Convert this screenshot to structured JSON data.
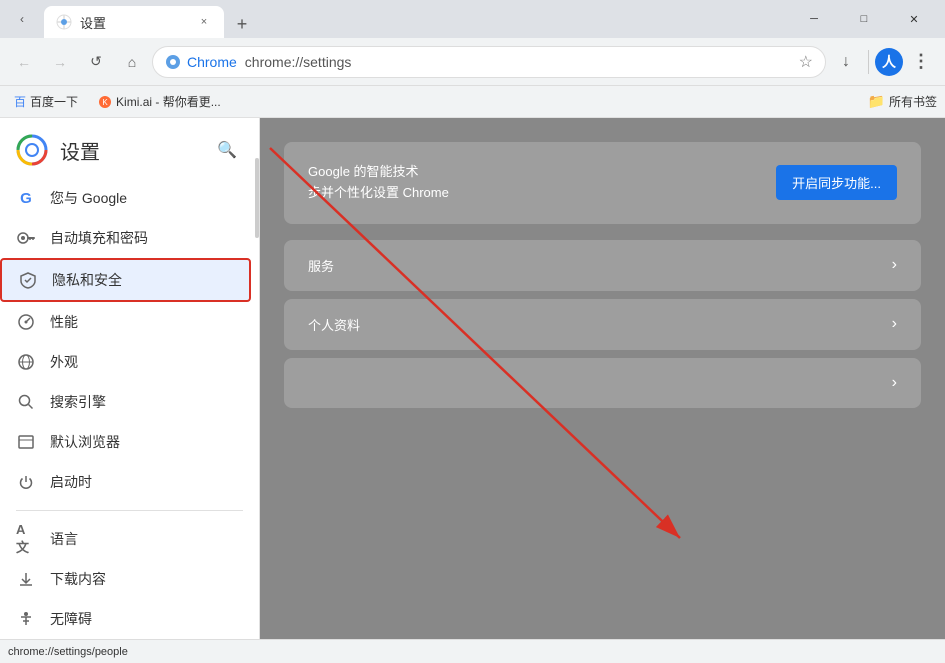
{
  "browser": {
    "tab": {
      "title": "设置",
      "close_label": "×",
      "new_tab_label": "+"
    },
    "window_controls": {
      "minimize": "─",
      "maximize": "□",
      "close": "✕"
    },
    "nav": {
      "back_disabled": true,
      "forward_disabled": true,
      "reload_label": "↺",
      "home_label": "⌂",
      "brand": "Chrome",
      "url": "chrome://settings",
      "bookmark_label": "☆",
      "download_label": "↓",
      "profile_label": "人",
      "menu_label": "⋮"
    },
    "bookmarks": [
      {
        "label": "百度一下"
      },
      {
        "label": "Kimi.ai - 帮你看更..."
      }
    ],
    "bookmarks_right": "所有书签",
    "status_url": "chrome://settings/people"
  },
  "settings": {
    "title": "设置",
    "search_icon": "🔍",
    "sidebar": [
      {
        "id": "google",
        "icon": "G",
        "label": "您与 Google",
        "active": false
      },
      {
        "id": "autofill",
        "icon": "🔑",
        "label": "自动填充和密码",
        "active": false
      },
      {
        "id": "privacy",
        "icon": "🛡",
        "label": "隐私和安全",
        "active": true
      },
      {
        "id": "performance",
        "icon": "📊",
        "label": "性能",
        "active": false
      },
      {
        "id": "appearance",
        "icon": "🌐",
        "label": "外观",
        "active": false
      },
      {
        "id": "search",
        "icon": "🔍",
        "label": "搜索引擎",
        "active": false
      },
      {
        "id": "default-browser",
        "icon": "⬜",
        "label": "默认浏览器",
        "active": false
      },
      {
        "id": "startup",
        "icon": "⏻",
        "label": "启动时",
        "active": false
      }
    ],
    "sidebar_bottom": [
      {
        "id": "language",
        "icon": "A",
        "label": "语言"
      },
      {
        "id": "downloads",
        "icon": "↓",
        "label": "下载内容"
      },
      {
        "id": "accessibility",
        "icon": "♿",
        "label": "无障碍"
      }
    ],
    "main": {
      "sync_card": {
        "text_line1": "Google 的智能技术",
        "text_line2": "步并个性化设置 Chrome",
        "button_label": "开启同步功能..."
      },
      "rows": [
        {
          "label": "服务",
          "has_arrow": true
        },
        {
          "label": "个人资料",
          "has_arrow": true
        },
        {
          "label": "",
          "has_arrow": true
        }
      ]
    }
  }
}
